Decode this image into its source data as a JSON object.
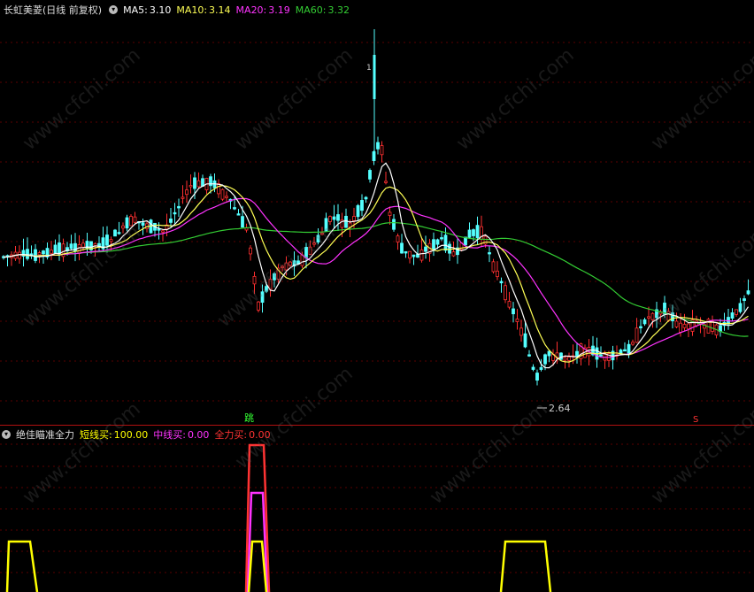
{
  "main": {
    "title": "长虹美菱",
    "period": "(日线 前复权)",
    "ma5": {
      "label": "MA5:",
      "value": "3.10",
      "color": "#ffffff"
    },
    "ma10": {
      "label": "MA10:",
      "value": "3.14",
      "color": "#ffff55"
    },
    "ma20": {
      "label": "MA20:",
      "value": "3.19",
      "color": "#ff33ff"
    },
    "ma60": {
      "label": "MA60:",
      "value": "3.32",
      "color": "#33cc33"
    },
    "low_label": "2.64",
    "high_marker": "1",
    "signal_jump": "跳",
    "signal_s": "S"
  },
  "indicator": {
    "name": "绝佳瞄准全力",
    "short": {
      "label": "短线买:",
      "value": "100.00",
      "color": "#ffff00"
    },
    "mid": {
      "label": "中线买:",
      "value": "0.00",
      "color": "#ff33ff"
    },
    "full": {
      "label": "全力买:",
      "value": "0.00",
      "color": "#ff3333"
    }
  },
  "watermark": "www.cfchi.com",
  "colors": {
    "up": "#ff3030",
    "down": "#54ffff",
    "grid": "#5a0000"
  }
}
